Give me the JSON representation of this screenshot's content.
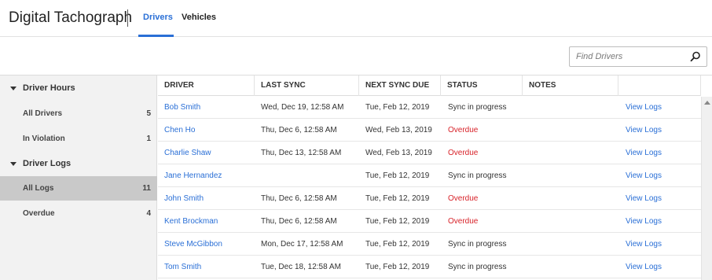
{
  "header": {
    "title": "Digital Tachograph",
    "tabs": [
      {
        "label": "Drivers",
        "active": true
      },
      {
        "label": "Vehicles",
        "active": false
      }
    ],
    "accent_color": "#2a6fd6"
  },
  "search": {
    "placeholder": "Find Drivers",
    "value": "",
    "icon": "search-icon"
  },
  "sidebar": {
    "groups": [
      {
        "label": "Driver Hours",
        "icon": "caret-down-icon",
        "items": [
          {
            "label": "All Drivers",
            "count": "5"
          },
          {
            "label": "In Violation",
            "count": "1"
          }
        ]
      },
      {
        "label": "Driver Logs",
        "icon": "caret-down-icon",
        "items": [
          {
            "label": "All Logs",
            "count": "11",
            "active": true
          },
          {
            "label": "Overdue",
            "count": "4"
          }
        ]
      }
    ]
  },
  "table": {
    "columns": [
      "DRIVER",
      "LAST SYNC",
      "NEXT SYNC DUE",
      "STATUS",
      "NOTES",
      ""
    ],
    "rows": [
      {
        "driver": "Bob Smith",
        "last_sync": "Wed, Dec 19, 12:58 AM",
        "next_sync": "Tue, Feb 12, 2019",
        "status": "Sync in progress",
        "status_type": "normal",
        "notes": "",
        "action": "View Logs"
      },
      {
        "driver": "Chen Ho",
        "last_sync": "Thu, Dec 6, 12:58 AM",
        "next_sync": "Wed, Feb 13, 2019",
        "status": "Overdue",
        "status_type": "overdue",
        "notes": "",
        "action": "View Logs"
      },
      {
        "driver": "Charlie Shaw",
        "last_sync": "Thu, Dec 13, 12:58 AM",
        "next_sync": "Wed, Feb 13, 2019",
        "status": "Overdue",
        "status_type": "overdue",
        "notes": "",
        "action": "View Logs"
      },
      {
        "driver": "Jane Hernandez",
        "last_sync": "",
        "next_sync": "Tue, Feb 12, 2019",
        "status": "Sync in progress",
        "status_type": "normal",
        "notes": "",
        "action": "View Logs"
      },
      {
        "driver": "John Smith",
        "last_sync": "Thu, Dec 6, 12:58 AM",
        "next_sync": "Tue, Feb 12, 2019",
        "status": "Overdue",
        "status_type": "overdue",
        "notes": "",
        "action": "View Logs"
      },
      {
        "driver": "Kent Brockman",
        "last_sync": "Thu, Dec 6, 12:58 AM",
        "next_sync": "Tue, Feb 12, 2019",
        "status": "Overdue",
        "status_type": "overdue",
        "notes": "",
        "action": "View Logs"
      },
      {
        "driver": "Steve McGibbon",
        "last_sync": "Mon, Dec 17, 12:58 AM",
        "next_sync": "Tue, Feb 12, 2019",
        "status": "Sync in progress",
        "status_type": "normal",
        "notes": "",
        "action": "View Logs"
      },
      {
        "driver": "Tom Smith",
        "last_sync": "Tue, Dec 18, 12:58 AM",
        "next_sync": "Tue, Feb 12, 2019",
        "status": "Sync in progress",
        "status_type": "normal",
        "notes": "",
        "action": "View Logs"
      }
    ],
    "overdue_color": "#d8232a",
    "link_color": "#2a6fd6"
  }
}
